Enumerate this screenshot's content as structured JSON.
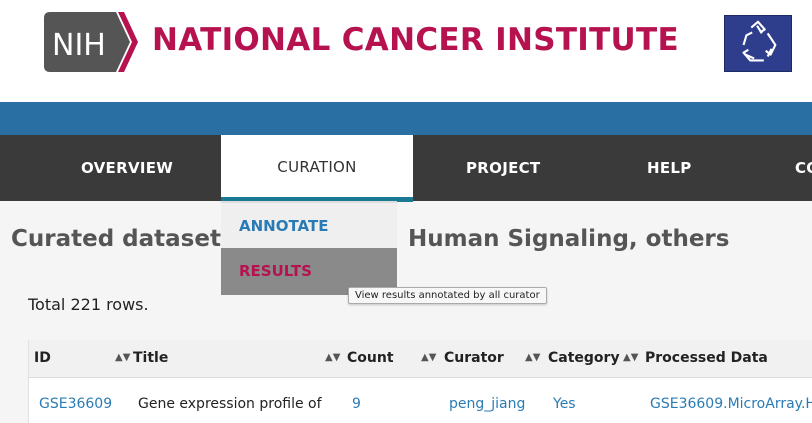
{
  "header": {
    "nih_text": "NIH",
    "title": "NATIONAL CANCER INSTITUTE",
    "brand_color": "#b5124f",
    "logo_icon": "recycle-icon"
  },
  "nav": {
    "items": [
      "OVERVIEW",
      "CURATION",
      "PROJECT",
      "HELP",
      "CO"
    ],
    "active": "CURATION"
  },
  "dropdown": {
    "items": [
      "ANNOTATE",
      "RESULTS"
    ],
    "hovered": "RESULTS"
  },
  "tooltip": "View results annotated by all curator",
  "page": {
    "heading_left": "Curated datasets",
    "heading_right": "Human Signaling, others",
    "total_rows": "Total 221 rows."
  },
  "table": {
    "columns": [
      "ID",
      "Title",
      "Count",
      "Curator",
      "Category",
      "Processed Data"
    ],
    "rows": [
      {
        "id": "GSE36609",
        "title": "Gene expression profile of",
        "count": "9",
        "curator": "peng_jiang",
        "category": "Yes",
        "processed": "GSE36609.MicroArray.H"
      }
    ]
  },
  "colors": {
    "blue_band": "#2a6fa4",
    "navbar": "#3a3a3a",
    "link": "#2a7bb5",
    "active_underline": "#1b7a93"
  }
}
